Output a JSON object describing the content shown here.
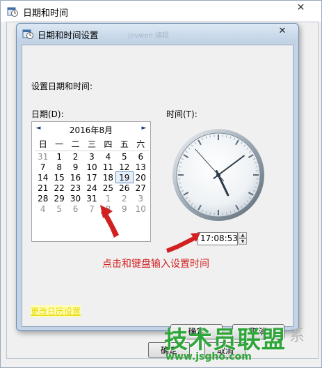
{
  "outer_window": {
    "title": "日期和时间",
    "close_glyph": "✕",
    "bottom_buttons": [
      "确定",
      "取消"
    ]
  },
  "dialog": {
    "title": "日期和时间设置",
    "ghost_text": "Jovwen  编辑",
    "close_glyph": "✕",
    "heading": "设置日期和时间:",
    "date_label": "日期(D):",
    "time_label": "时间(T):",
    "calendar": {
      "month_title": "2016年8月",
      "prev_glyph": "◄",
      "next_glyph": "►",
      "weekdays": [
        "日",
        "一",
        "二",
        "三",
        "四",
        "五",
        "六"
      ],
      "weeks": [
        [
          "31",
          "1",
          "2",
          "3",
          "4",
          "5",
          "6"
        ],
        [
          "7",
          "8",
          "9",
          "10",
          "11",
          "12",
          "13"
        ],
        [
          "14",
          "15",
          "16",
          "17",
          "18",
          "19",
          "20"
        ],
        [
          "21",
          "22",
          "23",
          "24",
          "25",
          "26",
          "27"
        ],
        [
          "28",
          "29",
          "30",
          "31",
          "1",
          "2",
          "3"
        ],
        [
          "4",
          "5",
          "6",
          "7",
          "8",
          "9",
          "10"
        ]
      ],
      "selected_day": "19"
    },
    "clock": {
      "hour": 17,
      "minute": 8,
      "second": 53
    },
    "time_value": "17:08:53",
    "annotation": "点击和键盘输入设置时间",
    "annotation_color": "#d21f1f",
    "change_calendar_link": "更改日历设置",
    "ok_button": "确定",
    "cancel_button": "取消"
  },
  "watermark": {
    "main": "技术员联盟",
    "url": "www.jsgho.com",
    "extra": "系",
    "color": "#2fa63a"
  }
}
